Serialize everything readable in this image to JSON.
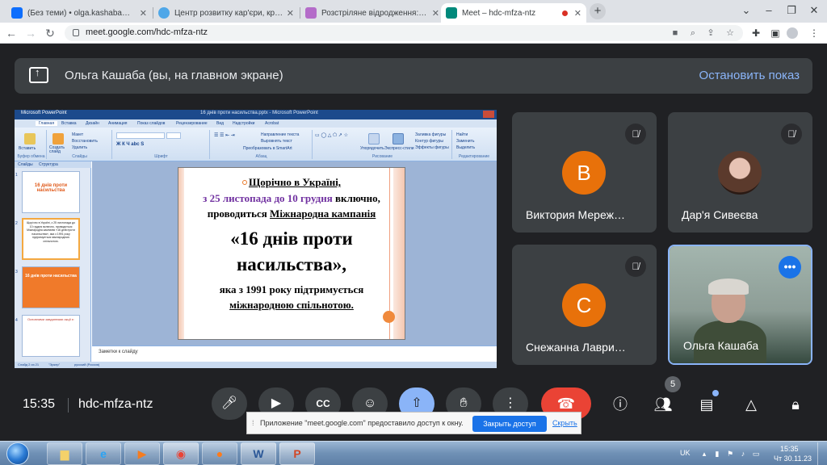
{
  "browser": {
    "tabs": [
      {
        "label": "(Без теми) • olga.kashaba@ukr.net",
        "favicon_color": "#0d6efd"
      },
      {
        "label": "Центр розвитку кар'єри, креати",
        "favicon_color": "#4fa7e8"
      },
      {
        "label": "Розстріляне відродження: наці",
        "favicon_color": "#b46cc9"
      },
      {
        "label": "Meet – hdc-mfza-ntz",
        "favicon_color": "#00897b",
        "active": true
      }
    ],
    "url": "meet.google.com/hdc-mfza-ntz",
    "new_tab": "+"
  },
  "meet": {
    "presenting_title": "Ольга Кашаба (вы, на главном экране)",
    "stop_button": "Остановить показ",
    "clock": "15:35",
    "meeting_code": "hdc-mfza-ntz",
    "participant_count": "5",
    "participants": [
      {
        "name": "Виктория Мереж…",
        "initial": "В",
        "type": "avatar",
        "muted": true
      },
      {
        "name": "Дар'я Сивеєва",
        "type": "photo",
        "muted": true
      },
      {
        "name": "Снежанна Лаври…",
        "initial": "С",
        "type": "avatar",
        "muted": true
      },
      {
        "name": "Ольга Кашаба",
        "type": "video",
        "muted": false
      }
    ]
  },
  "powerpoint": {
    "app_name": "Microsoft PowerPoint",
    "doc_title": "16 днів проти насильства.pptx - Microsoft PowerPoint",
    "tabs": [
      "Главная",
      "Вставка",
      "Дизайн",
      "Анимация",
      "Показ слайдов",
      "Рецензирование",
      "Вид",
      "Надстройки",
      "Acrobat"
    ],
    "ribbon_groups": [
      "Буфер обмена",
      "Слайды",
      "Шрифт",
      "Абзац",
      "Рисование",
      "Редактирование"
    ],
    "ribbon_items": {
      "paste": "Вставить",
      "create_slide": "Создать слайд",
      "delete": "Удалить",
      "layout": "Макет",
      "restore": "Восстановить",
      "text_direction": "Направление текста",
      "align_text": "Выровнять текст",
      "smartart": "Преобразовать в SmartArt",
      "arrange": "Упорядочить",
      "quick_styles": "Экспресс-стили",
      "shape_fill": "Заливка фигуры",
      "shape_outline": "Контур фигуры",
      "shape_effects": "Эффекты фигуры",
      "find": "Найти",
      "replace": "Заменить",
      "select": "Выделить"
    },
    "left_tabs": [
      "Слайды",
      "Структура"
    ],
    "thumb1_text": "16 днів проти насильства",
    "thumb2_text": "Щорічно в Україні, з 25 листопада до 10 грудня включно, проводиться Міжнародна кампанія «16 днів проти насильства», яка з 1991 року підтримується міжнародною спільнотою.",
    "thumb3_text": "16 днів проти насильства",
    "thumb4_text": "Основними завданнями акції є:",
    "slide": {
      "line1": "Щорічно в Україні,",
      "line2a": "з 25 листопада до 10 грудня",
      "line2b": " включно,",
      "line3a": "проводиться ",
      "line3b": "Міжнародна кампанія",
      "line4": "«16 днів проти",
      "line5": "насильства»,",
      "line6": "яка з 1991 року підтримується",
      "line7": "міжнародною спільнотою."
    },
    "notes_placeholder": "Заметки к слайду",
    "status": {
      "slide_num": "Слайд 2 из 21",
      "theme": "\"Эркер\"",
      "language": "русский (Россия)"
    }
  },
  "notification": {
    "text": "Приложение \"meet.google.com\" предоставило доступ к окну.",
    "close_button": "Закрыть доступ",
    "hide_link": "Скрыть"
  },
  "taskbar": {
    "language": "UK",
    "time": "15:35",
    "date": "Чт 30.11.23"
  },
  "colors": {
    "meet_bg": "#202124",
    "tile_bg": "#3c4043",
    "accent_blue": "#8ab4f8",
    "hangup_red": "#ea4335",
    "avatar_orange": "#e8710a"
  }
}
